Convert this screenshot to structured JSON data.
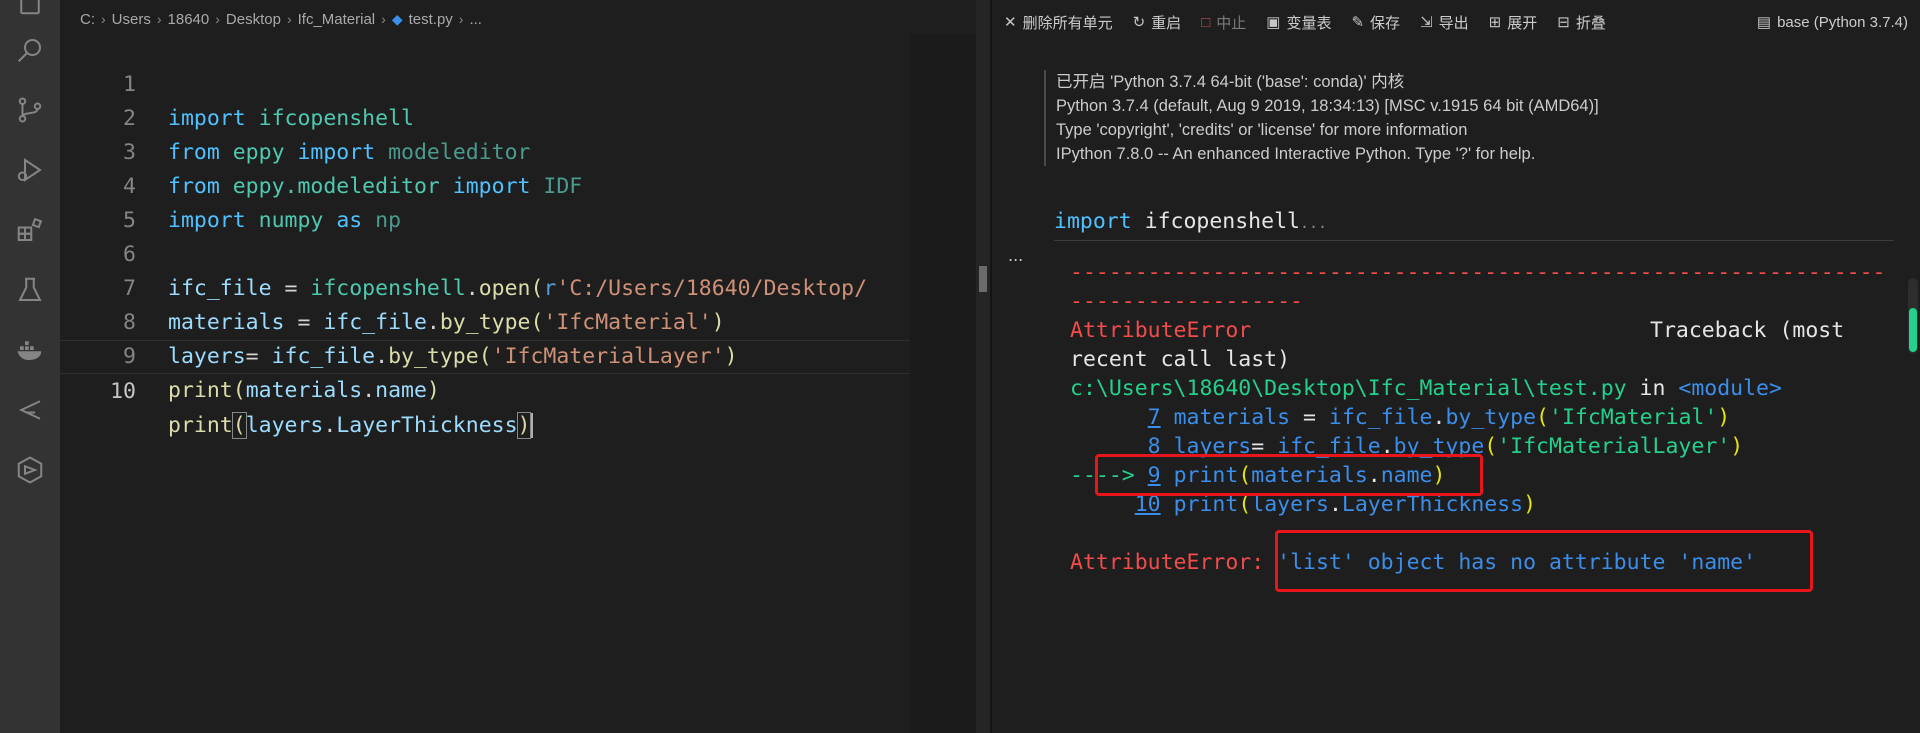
{
  "breadcrumb": [
    "C:",
    "Users",
    "18640",
    "Desktop",
    "Ifc_Material",
    "test.py",
    "..."
  ],
  "editor": {
    "lines": [
      {
        "n": "1"
      },
      {
        "n": "2"
      },
      {
        "n": "3"
      },
      {
        "n": "4"
      },
      {
        "n": "5"
      },
      {
        "n": "6"
      },
      {
        "n": "7"
      },
      {
        "n": "8"
      },
      {
        "n": "9"
      },
      {
        "n": "10"
      }
    ],
    "code": {
      "l1": [
        "import",
        "ifcopenshell"
      ],
      "l2": [
        "from",
        "eppy",
        "import",
        "modeleditor"
      ],
      "l3": [
        "from",
        "eppy.modeleditor",
        "import",
        "IDF"
      ],
      "l4": [
        "import",
        "numpy",
        "as",
        "np"
      ],
      "l6": [
        "ifc_file",
        " = ",
        "ifcopenshell",
        ".",
        "open",
        "(",
        "r",
        "'C:/Users/18640/Desktop/"
      ],
      "l7": [
        "materials",
        " = ",
        "ifc_file",
        ".",
        "by_type",
        "(",
        "'IfcMaterial'",
        ")"
      ],
      "l8": [
        "layers",
        "= ",
        "ifc_file",
        ".",
        "by_type",
        "(",
        "'IfcMaterialLayer'",
        ")"
      ],
      "l9": [
        "print",
        "(",
        "materials",
        ".",
        "name",
        ")"
      ],
      "l10": [
        "print",
        "(",
        "layers",
        ".",
        "LayerThickness",
        ")"
      ]
    }
  },
  "toolbar": {
    "clear_all": "删除所有单元",
    "restart": "重启",
    "interrupt": "中止",
    "variables": "变量表",
    "save": "保存",
    "export": "导出",
    "expand": "展开",
    "collapse": "折叠",
    "kernel": "base (Python 3.7.4)"
  },
  "kernel_info": [
    "已开启 'Python 3.7.4 64-bit ('base': conda)' 内核",
    "Python 3.7.4 (default, Aug 9 2019, 18:34:13) [MSC v.1915 64 bit (AMD64)]",
    "Type 'copyright', 'credits' or 'license' for more information",
    "IPython 7.8.0 -- An enhanced Interactive Python. Type '?' for help."
  ],
  "input_cell": {
    "kw": "import",
    "mod": "ifcopenshell",
    "more": "..."
  },
  "prompt_ellipsis": "...",
  "output": {
    "dash1": "---------------------------------------------------------------",
    "dash2": "------------------",
    "err_name": "AttributeError",
    "traceback": "Traceback (most",
    "recent": "recent call last)",
    "path": "c:\\Users\\18640\\Desktop\\Ifc_Material\\test.py",
    "in": " in ",
    "module": "<module>",
    "t7": {
      "n": "7",
      "a": "materials",
      "b": " = ",
      "c": "ifc_file",
      "d": ".",
      "e": "by_type",
      "f": "(",
      "g": "'IfcMaterial'",
      "h": ")"
    },
    "t8": {
      "n": "8",
      "a": "layers",
      "b": "= ",
      "c": "ifc_file",
      "d": ".",
      "e": "by_type",
      "f": "(",
      "g": "'IfcMaterialLayer'",
      "h": ")"
    },
    "arrow": "----> ",
    "t9": {
      "n": "9",
      "a": "print",
      "b": "(",
      "c": "materials",
      "d": ".",
      "e": "name",
      "f": ")"
    },
    "t10": {
      "n": "10",
      "a": "print",
      "b": "(",
      "c": "layers",
      "d": ".",
      "e": "LayerThickness",
      "f": ")"
    },
    "final_err": "AttributeError:",
    "final_msg": "'list' object has no attribute 'name'"
  }
}
